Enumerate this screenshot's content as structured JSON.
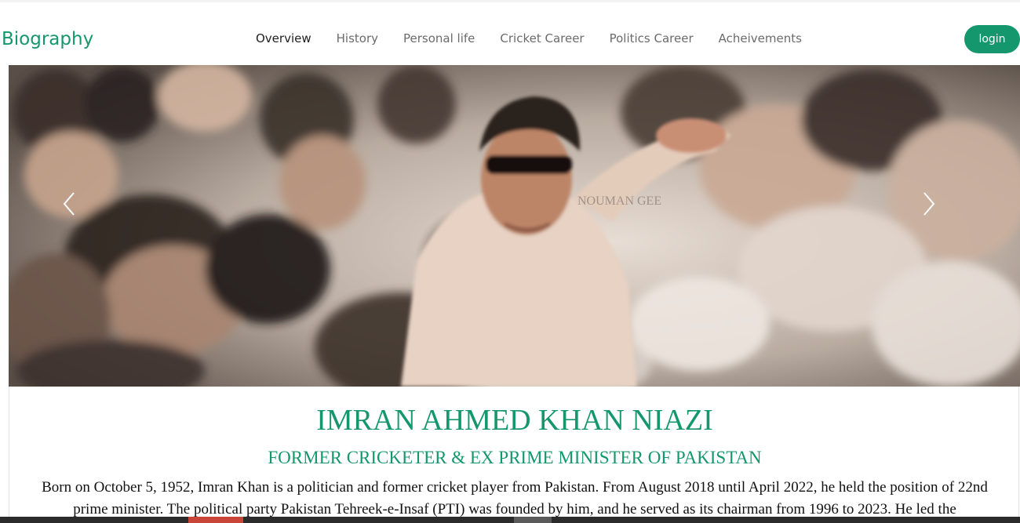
{
  "nav": {
    "brand": "Biography",
    "links": [
      {
        "label": "Overview",
        "active": true
      },
      {
        "label": "History",
        "active": false
      },
      {
        "label": "Personal life",
        "active": false
      },
      {
        "label": "Cricket Career",
        "active": false
      },
      {
        "label": "Politics Career",
        "active": false
      },
      {
        "label": "Acheivements",
        "active": false
      }
    ],
    "login_label": "login"
  },
  "carousel": {
    "watermark": "NOUMAN GEE",
    "prev_icon": "chevron-left-icon",
    "next_icon": "chevron-right-icon"
  },
  "content": {
    "title": "IMRAN AHMED KHAN NIAZI",
    "subtitle": "FORMER CRICKETER & EX PRIME MINISTER OF PAKISTAN",
    "bio": "Born on October 5, 1952, Imran Khan is a politician and former cricket player from Pakistan. From August 2018 until April 2022, he held the position of 22nd prime minister. The political party Pakistan Tehreek-e-Insaf (PTI) was founded by him, and he served as its chairman from 1996 to 2023. He led the"
  },
  "colors": {
    "accent": "#14976c",
    "nav_active": "#1f1f1f",
    "nav_inactive": "#6b6b6b"
  }
}
